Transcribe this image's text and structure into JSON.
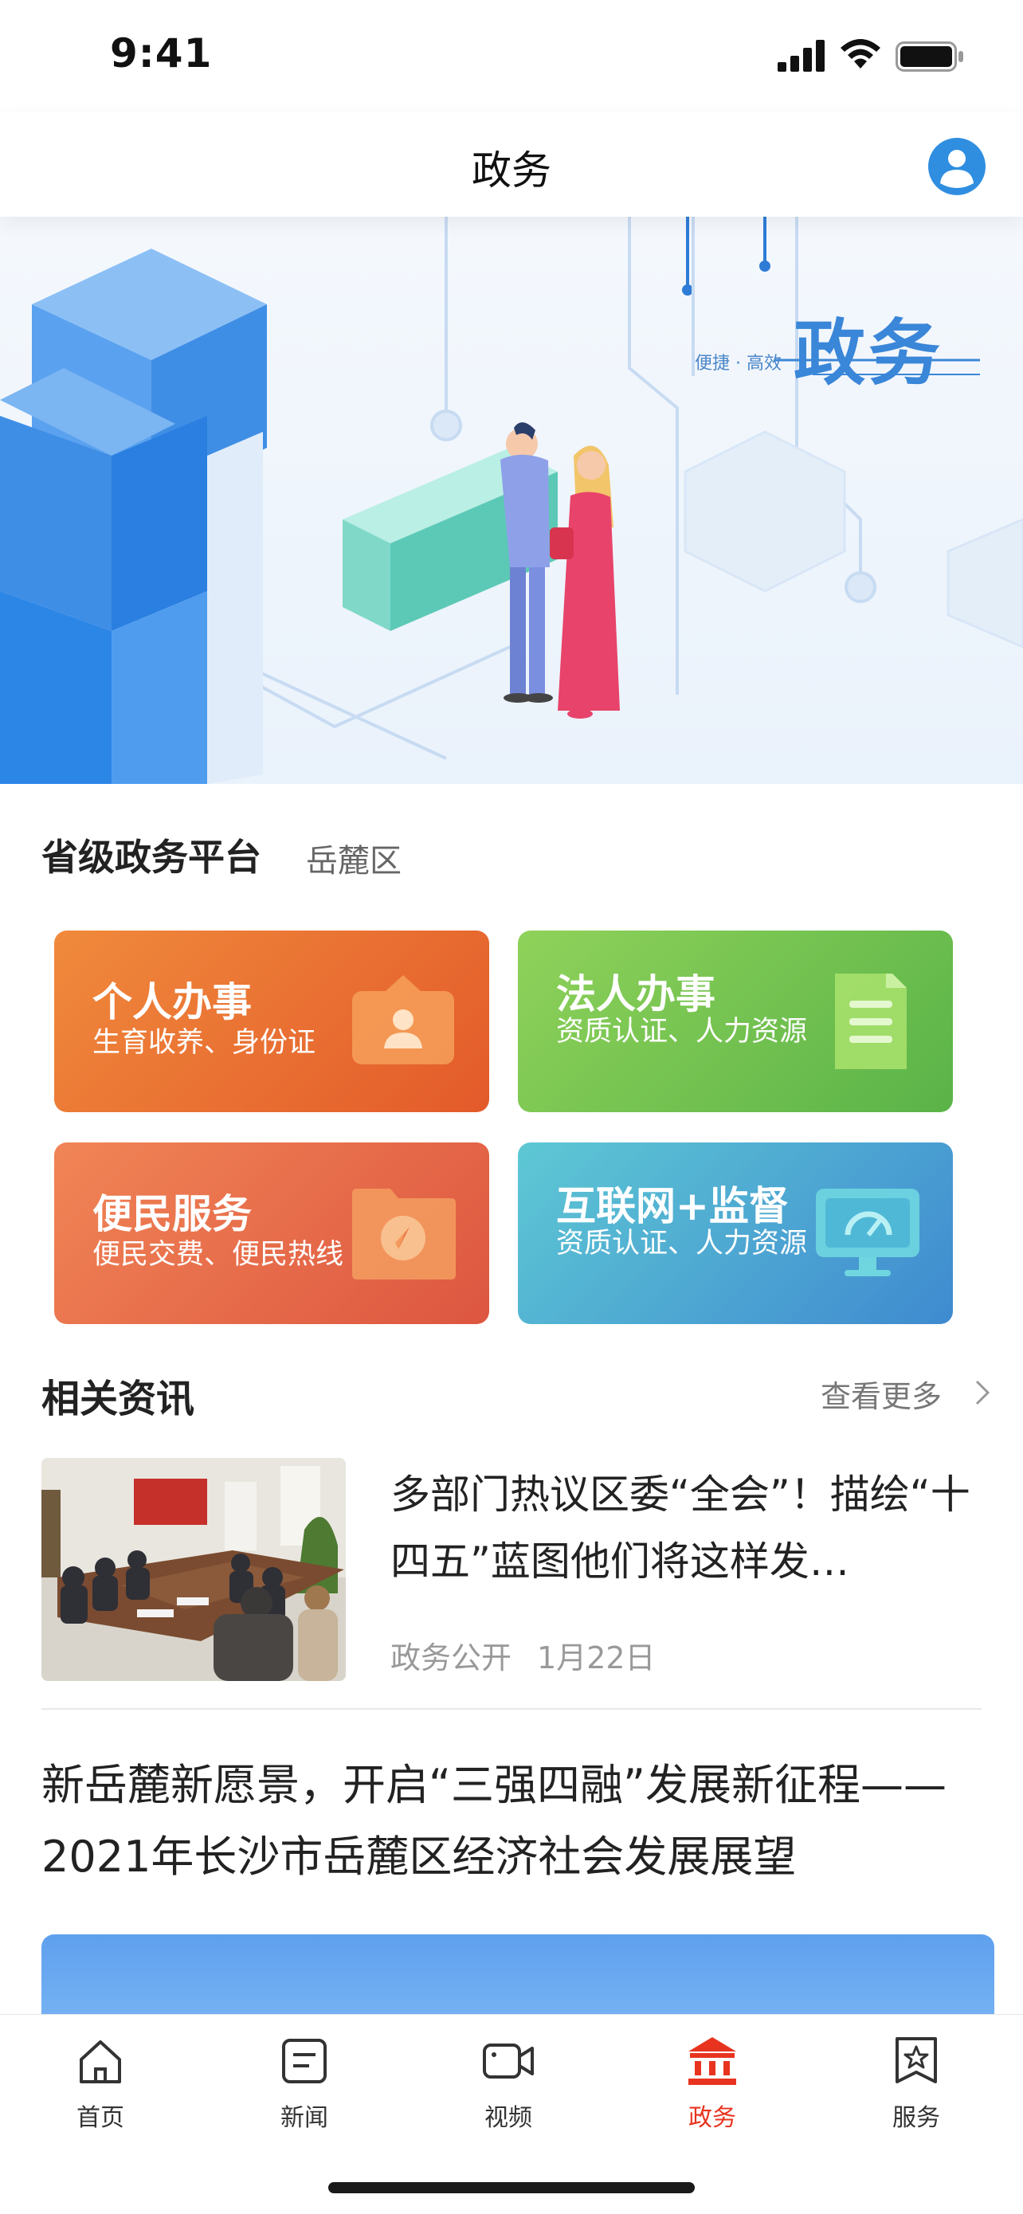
{
  "status_bar": {
    "time": "9:41"
  },
  "header": {
    "title": "政务"
  },
  "banner": {
    "title": "政务",
    "subtitle": "便捷 · 高效"
  },
  "platform": {
    "title": "省级政务平台",
    "region": "岳麓区"
  },
  "services": [
    {
      "title": "个人办事",
      "subtitle": "生育收养、身份证",
      "icon": "id-card-icon",
      "color": "#e96a33"
    },
    {
      "title": "法人办事",
      "subtitle": "资质认证、人力资源",
      "icon": "document-icon",
      "color": "#72c250"
    },
    {
      "title": "便民服务",
      "subtitle": "便民交费、便民热线",
      "icon": "folder-compass-icon",
      "color": "#e66e4b"
    },
    {
      "title": "互联网+监督",
      "subtitle": "资质认证、人力资源",
      "icon": "monitor-icon",
      "color": "#4aa7d2"
    }
  ],
  "news": {
    "title": "相关资讯",
    "more": "查看更多",
    "items": [
      {
        "headline": "多部门热议区委“全会”！描绘“十四五”蓝图他们将这样发…",
        "source": "政务公开",
        "date": "1月22日"
      }
    ],
    "feature_headline": "新岳麓新愿景，开启“三强四融”发展新征程——2021年长沙市岳麓区经济社会发展展望"
  },
  "tabbar": {
    "active": "政务",
    "active_color": "#e8341f",
    "items": [
      {
        "label": "首页",
        "icon": "home-icon"
      },
      {
        "label": "新闻",
        "icon": "news-icon"
      },
      {
        "label": "视频",
        "icon": "video-icon"
      },
      {
        "label": "政务",
        "icon": "government-icon"
      },
      {
        "label": "服务",
        "icon": "service-star-icon"
      }
    ]
  }
}
